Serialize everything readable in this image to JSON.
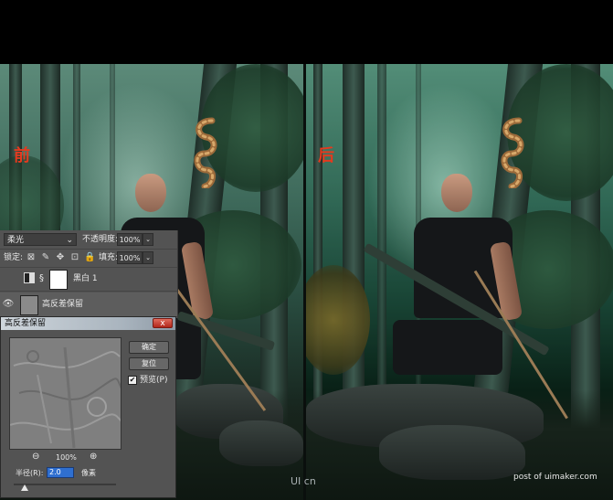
{
  "labels": {
    "before": "前",
    "after": "后"
  },
  "layers_panel": {
    "blend_mode": "柔光",
    "opacity_label": "不透明度:",
    "opacity_value": "100%",
    "lock_label": "锁定:",
    "fill_label": "填充:",
    "fill_value": "100%",
    "layers": [
      {
        "name": "黑白 1"
      },
      {
        "name": "高反差保留"
      }
    ]
  },
  "high_pass_dialog": {
    "title": "高反差保留",
    "close": "x",
    "ok_label": "确定",
    "reset_label": "复位",
    "preview_label": "预览(P)",
    "preview_checked": true,
    "zoom_value": "100%",
    "radius_label": "半径(R):",
    "radius_value": "2.0",
    "radius_unit": "像素"
  },
  "watermark": {
    "logo": "UI cn",
    "text": "post of uimaker.com"
  },
  "colors": {
    "label_red": "#e33a1f",
    "panel_gray": "#535353",
    "selection_blue": "#2f6fd0"
  }
}
